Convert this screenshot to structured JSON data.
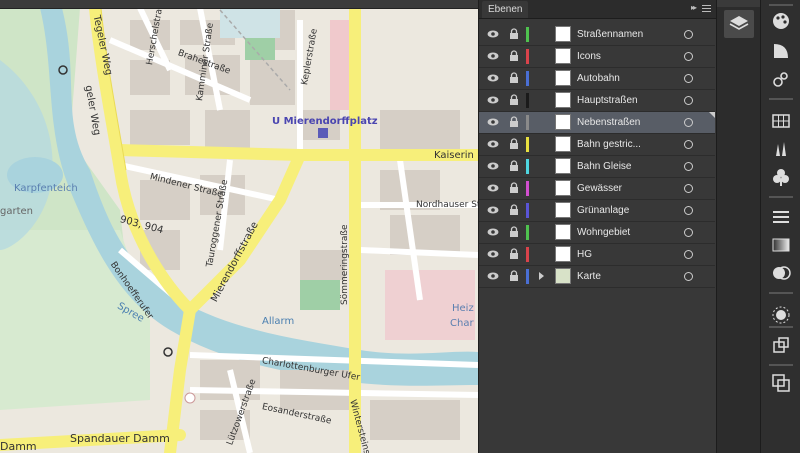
{
  "panel": {
    "tab_label": "Ebenen",
    "collapse_glyph": "▸▸"
  },
  "layers": [
    {
      "name": "Straßennamen",
      "color": "#4fc24f",
      "selected": false,
      "expandable": false
    },
    {
      "name": "Icons",
      "color": "#d9434b",
      "selected": false,
      "expandable": false
    },
    {
      "name": "Autobahn",
      "color": "#4a6fd4",
      "selected": false,
      "expandable": false
    },
    {
      "name": "Hauptstraßen",
      "color": "#1a1a1a",
      "selected": false,
      "expandable": false
    },
    {
      "name": "Nebenstraßen",
      "color": "#8a8a8a",
      "selected": true,
      "expandable": false
    },
    {
      "name": "Bahn gestric...",
      "color": "#e8e040",
      "selected": false,
      "expandable": false
    },
    {
      "name": "Bahn Gleise",
      "color": "#4fd6e0",
      "selected": false,
      "expandable": false
    },
    {
      "name": "Gewässer",
      "color": "#d24fd0",
      "selected": false,
      "expandable": false
    },
    {
      "name": "Grünanlage",
      "color": "#5a55d6",
      "selected": false,
      "expandable": false
    },
    {
      "name": "Wohngebiet",
      "color": "#4fc24f",
      "selected": false,
      "expandable": false
    },
    {
      "name": "HG",
      "color": "#d9434b",
      "selected": false,
      "expandable": false
    },
    {
      "name": "Karte",
      "color": "#4a6fd4",
      "selected": false,
      "expandable": true
    }
  ],
  "map": {
    "labels": {
      "tegeler_weg": "Tegeler Weg",
      "tegeler_weg2": "geler Weg",
      "u_mierendorffplatz": "U Mierendorffplatz",
      "kaiserin": "Kaiserin",
      "karpfenteich": "Karpfenteich",
      "garten": "garten",
      "mindener": "Mindener Straße",
      "kamminer": "Kamminer Straße",
      "herschel": "Herschelstraße",
      "brahe": "Brahestraße",
      "keplerstrasse": "Keplerstraße",
      "mierendorffstrasse": "Mierendorffstraße",
      "tauroggener": "Tauroggener Straße",
      "nordhauser": "Nordhauser Straße",
      "sommering": "Sömmeringstraße",
      "bonhoeffer": "Bonhoefferufer",
      "spree": "Spree",
      "allarm": "Allarm",
      "charlottenburger": "Charlottenburger Ufer",
      "spandauer": "Spandauer Damm",
      "damm": "Damm",
      "eosander": "Eosanderstraße",
      "luetzow": "Lützowerstraße",
      "wintersteinstr": "Wintersteinstr",
      "heiz": "Heiz",
      "char": "Char",
      "route_no": "903, 904"
    }
  }
}
